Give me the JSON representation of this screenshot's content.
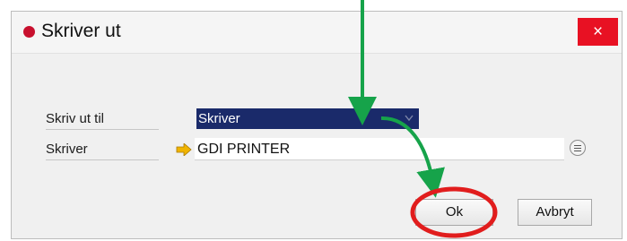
{
  "dialog": {
    "title": "Skriver ut",
    "close_glyph": "×",
    "rows": [
      {
        "label": "Skriv ut til",
        "value": "Skriver"
      },
      {
        "label": "Skriver",
        "value": "GDI PRINTER"
      }
    ],
    "buttons": {
      "ok": "Ok",
      "cancel": "Avbryt"
    }
  },
  "icons": {
    "title_status": "red-dot-icon",
    "close": "close-icon",
    "dropdown": "chevron-down-icon",
    "row_pointer": "arrow-right-icon",
    "lookup": "list-lookup-icon"
  },
  "colors": {
    "close_button": "#e81123",
    "title_dot": "#c8102e",
    "selected_field": "#1a2a6a",
    "pointer_arrow": "#f0b400",
    "annotation_arrow": "#16a34a",
    "annotation_circle": "#e11d1d"
  }
}
